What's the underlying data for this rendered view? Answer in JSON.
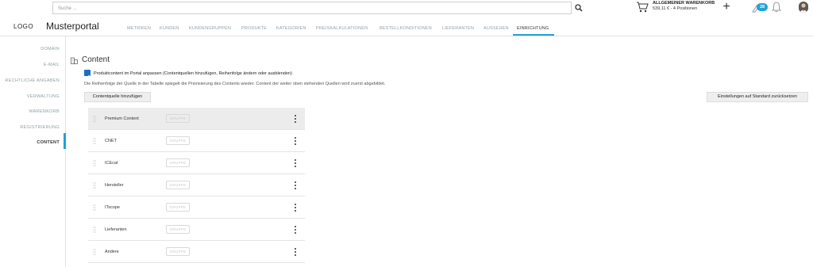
{
  "header": {
    "search_placeholder": "Suche ...",
    "cart_title": "ALLGEMEINER WARENKORB",
    "cart_sub": "539,11 € - 4 Positionen",
    "plus_label": "+",
    "notif_count": "28"
  },
  "nav": {
    "logo": "LOGO",
    "portal": "Musterportal",
    "items": [
      "METRIKEN",
      "KUNDEN",
      "KUNDENGRUPPEN",
      "PRODUKTE",
      "KATEGORIEN",
      "PREISKALKULATIONEN",
      "BESTELLKONDITIONEN",
      "LIEFERANTEN",
      "AUSSEHEN",
      "EINRICHTUNG"
    ],
    "active": "EINRICHTUNG"
  },
  "sidebar": {
    "items": [
      "DOMAIN",
      "E-MAIL",
      "RECHTLICHE ANGABEN",
      "VERWALTUNG",
      "WARENKORB",
      "REGISTRIERUNG",
      "CONTENT"
    ],
    "active": "CONTENT"
  },
  "main": {
    "title": "Content",
    "checkbox_label": "Produktcontent im Portal anpassen (Contentquellen hinzufügen, Reihenfolge ändern oder ausblenden)",
    "checkbox_checked": true,
    "description": "Die Reihenfolge der Quelle in der Tabelle spiegelt die Priorisierung des Contents wieder. Content der weiter oben stehenden Quellen wird zuerst abgebildet.",
    "add_button": "Contentquelle hinzufügen",
    "reset_button": "Einstellungen auf Standard zurücksetzen",
    "group_label": "GRUPPE",
    "rows": [
      "Premium Content",
      "CNET",
      "ICEcat",
      "Hersteller",
      "ITscope",
      "Lieferanten",
      "Andere"
    ]
  },
  "colors": {
    "accent": "#1fa3d8",
    "checkbox": "#1a6fc4",
    "nav_inactive": "#8fa0a8"
  }
}
